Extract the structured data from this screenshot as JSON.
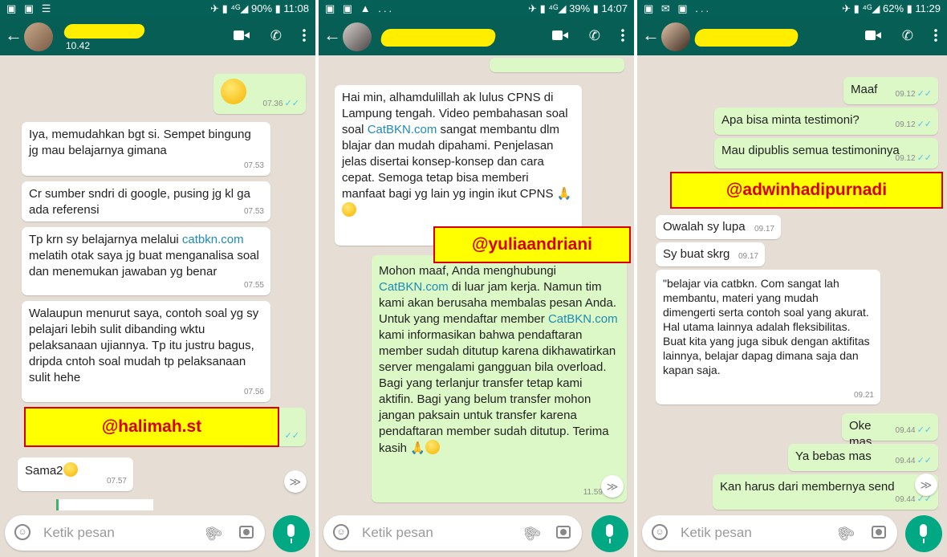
{
  "panels": [
    {
      "status": {
        "left": "▣ ▣ ☰",
        "right": "✈ ▮ ⁴ᴳ◢ 90% ▮ 11:08"
      },
      "header": {
        "subtitle": "10.42"
      },
      "messages": [
        {
          "time": "07.36",
          "tick": "✓✓"
        },
        {
          "text": "Iya, memudahkan bgt si. Sempet bingung jg mau belajarnya gimana",
          "time": "07.53"
        },
        {
          "text": "Cr sumber sndri di google, pusing jg kl ga ada referensi",
          "time": "07.53"
        },
        {
          "pre": "Tp krn sy belajarnya melalui",
          "link": "catbkn.com",
          "post": " melatih otak saya jg buat menganalisa soal dan menemukan jawaban yg benar",
          "time": "07.55"
        },
        {
          "text": "Walaupun menurut saya, contoh soal yg sy pelajari lebih sulit dibanding wktu pelaksanaan ujiannya. Tp itu justru bagus, dripda cntoh soal mudah tp pelaksanaan sulit hehe",
          "time": "07.56"
        },
        {
          "tick": "✓✓"
        },
        {
          "text": "Sama2",
          "time": "07.57"
        }
      ],
      "tag": "@halimah.st",
      "input_placeholder": "Ketik pesan",
      "scroll_glyph": "≫"
    },
    {
      "status": {
        "left": "▣ ▣ ▲ ...",
        "right": "✈ ▮ ⁴ᴳ◢ 39% ▮ 14:07"
      },
      "messages": [
        {
          "pre": "Hai min, alhamdulillah ak lulus CPNS di Lampung tengah. Video pembahasan soal soal ",
          "link": "CatBKN.com",
          "post": " sangat membantu dlm blajar dan mudah dipahami. Penjelasan jelas disertai konsep-konsep dan cara cepat. Semoga tetap bisa memberi manfaat bagi yg lain yg ingin ikut CPNS 🙏"
        },
        {
          "pre": "Mohon maaf, Anda menghubungi ",
          "link": "CatBKN.com",
          "mid": " di luar jam kerja. Namun tim kami akan berusaha membalas pesan Anda. Untuk yang mendaftar member ",
          "link2": "CatBKN.com",
          "post": " kami informasikan bahwa pendaftaran member sudah ditutup karena dikhawatirkan server mengalami gangguan bila overload. Bagi yang terlanjur transfer tetap kami aktifin. Bagi yang belum transfer mohon jangan paksain untuk transfer karena pendaftaran member sudah ditutup. Terima kasih 🙏",
          "time": "11.59"
        }
      ],
      "tag": "@yuliaandriani",
      "input_placeholder": "Ketik pesan",
      "scroll_glyph": "≫"
    },
    {
      "status": {
        "left": "▣ ✉ ▣ ...",
        "right": "✈ ▮ ⁴ᴳ◢ 62% ▮ 11:29"
      },
      "messages": [
        {
          "text": "Maaf",
          "time": "09.12",
          "tick": "✓✓"
        },
        {
          "text": "Apa bisa minta testimoni?",
          "time": "09.12",
          "tick": "✓✓"
        },
        {
          "text": "Mau dipublis semua testimoninya",
          "time": "09.12",
          "tick": "✓✓"
        },
        {
          "text": "Owalah sy lupa",
          "time": "09.17"
        },
        {
          "text": "Sy buat skrg",
          "time": "09.17"
        },
        {
          "text": "\"belajar via catbkn. Com sangat lah membantu, materi yang mudah dimengerti serta contoh soal yang akurat. Hal utama lainnya adalah fleksibilitas. Buat kita yang juga sibuk dengan aktifitas lainnya,  belajar dapag dimana saja dan kapan saja.",
          "time": "09.21"
        },
        {
          "text": "Oke mas",
          "time": "09.44",
          "tick": "✓✓"
        },
        {
          "text": "Ya bebas mas",
          "time": "09.44",
          "tick": "✓✓"
        },
        {
          "text": "Kan harus dari membernya send",
          "time": "09.44",
          "tick": "✓✓"
        }
      ],
      "tag": "@adwinhadipurnadi",
      "input_placeholder": "Ketik pesan",
      "scroll_glyph": "≫"
    }
  ],
  "colors": {
    "header": "#075e54",
    "statusbar": "#056157",
    "outgoing": "#dcf8c6",
    "incoming": "#ffffff",
    "tag_bg": "#ffff00",
    "tag_border": "#d60000",
    "link": "#1f8bb5",
    "mic": "#00a884"
  },
  "icons": {
    "back": "←",
    "phone": "✆",
    "clip": "🖇"
  }
}
